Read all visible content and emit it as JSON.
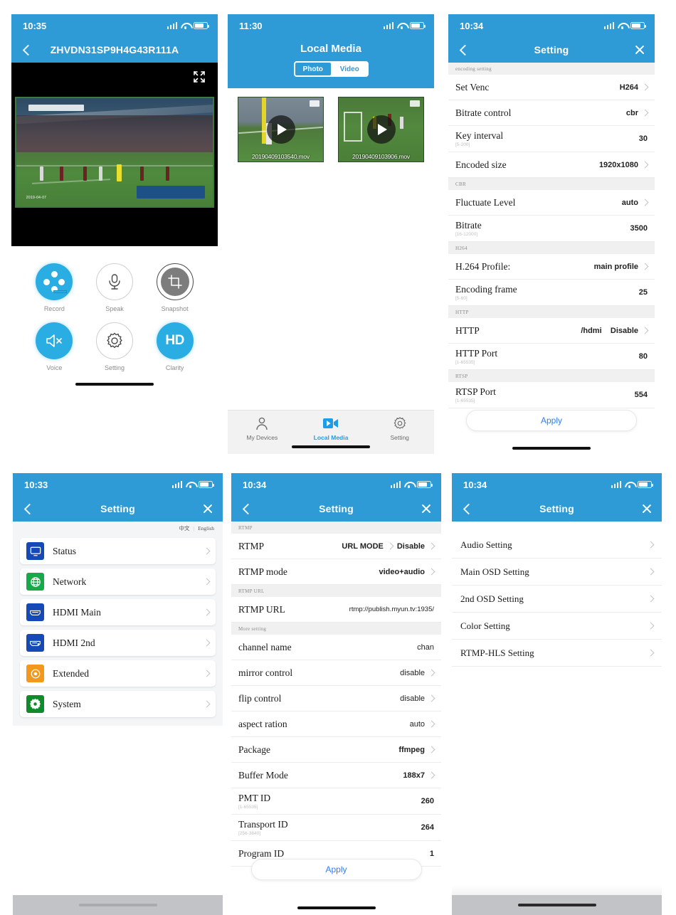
{
  "panel1": {
    "status_time": "10:35",
    "nav_title": "ZHVDN31SP9H4G43R111A",
    "video_timestamp": "2019-04-07",
    "controls": [
      {
        "label": "Record",
        "icon": "film-reel-icon"
      },
      {
        "label": "Speak",
        "icon": "microphone-icon"
      },
      {
        "label": "Snapshot",
        "icon": "crop-icon"
      },
      {
        "label": "Voice",
        "icon": "speaker-mute-icon"
      },
      {
        "label": "Setting",
        "icon": "gear-icon"
      },
      {
        "label": "Clarity",
        "icon": "hd-icon"
      }
    ],
    "clarity_text": "HD"
  },
  "panel2": {
    "status_time": "11:30",
    "nav_title": "Local Media",
    "segments": [
      {
        "label": "Photo",
        "active": true
      },
      {
        "label": "Video",
        "active": false
      }
    ],
    "media": [
      {
        "filename": "20190409103540.mov"
      },
      {
        "filename": "20190409103906.mov"
      }
    ],
    "tabs": [
      {
        "label": "My Devices",
        "icon": "person-icon",
        "active": false
      },
      {
        "label": "Local Media",
        "icon": "video-camera-icon",
        "active": true
      },
      {
        "label": "Setting",
        "icon": "gear-icon",
        "active": false
      }
    ]
  },
  "panel3": {
    "status_time": "10:34",
    "nav_title": "Setting",
    "sections": [
      {
        "header": "encoding setting",
        "rows": [
          {
            "label": "Set Venc",
            "sub": "",
            "value": "H264",
            "chevron": true
          },
          {
            "label": "Bitrate control",
            "sub": "",
            "value": "cbr",
            "chevron": true
          },
          {
            "label": "Key interval",
            "sub": "[5-200]",
            "value": "30",
            "chevron": false
          },
          {
            "label": "Encoded size",
            "sub": "",
            "value": "1920x1080",
            "chevron": true
          }
        ]
      },
      {
        "header": "CBR",
        "rows": [
          {
            "label": "Fluctuate Level",
            "sub": "",
            "value": "auto",
            "chevron": true
          },
          {
            "label": "Bitrate",
            "sub": "[16-12000]",
            "value": "3500",
            "chevron": false
          }
        ]
      },
      {
        "header": "H264",
        "rows": [
          {
            "label": "H.264 Profile:",
            "sub": "",
            "value": "main profile",
            "chevron": true
          },
          {
            "label": "Encoding frame",
            "sub": "[5-60]",
            "value": "25",
            "chevron": false
          }
        ]
      },
      {
        "header": "HTTP",
        "rows": [
          {
            "label": "HTTP",
            "sub": "",
            "value": "/hdmi    Disable",
            "chevron": true
          },
          {
            "label": "HTTP Port",
            "sub": "[1-65535]",
            "value": "80",
            "chevron": false
          }
        ]
      },
      {
        "header": "RTSP",
        "rows": [
          {
            "label": "RTSP Port",
            "sub": "[1-65535]",
            "value": "554",
            "chevron": false
          }
        ]
      }
    ],
    "apply_label": "Apply"
  },
  "panel4": {
    "status_time": "10:33",
    "nav_title": "Setting",
    "lang_cn": "中文",
    "lang_sep": "|",
    "lang_en": "English",
    "items": [
      {
        "label": "Status",
        "icon": "monitor-icon",
        "color": "blue-ic"
      },
      {
        "label": "Network",
        "icon": "globe-icon",
        "color": "green-ic"
      },
      {
        "label": "HDMI Main",
        "icon": "hdmi-port-icon",
        "color": "blue-ic"
      },
      {
        "label": "HDMI 2nd",
        "icon": "hdmi-port-icon",
        "color": "blue-ic"
      },
      {
        "label": "Extended",
        "icon": "target-icon",
        "color": "orange-ic"
      },
      {
        "label": "System",
        "icon": "gear-icon",
        "color": "darkgreen-ic"
      }
    ]
  },
  "panel5": {
    "status_time": "10:34",
    "nav_title": "Setting",
    "sections": [
      {
        "header": "RTMP",
        "rows": [
          {
            "label": "RTMP",
            "sub": "",
            "value": "URL MODE",
            "value2": "Disable",
            "chevron": true
          },
          {
            "label": "RTMP mode",
            "sub": "",
            "value": "video+audio",
            "chevron": true
          }
        ]
      },
      {
        "header": "RTMP URL",
        "rows": [
          {
            "label": "RTMP URL",
            "sub": "",
            "value": "rtmp://publish.myun.tv:1935/",
            "chevron": false,
            "thin": true
          }
        ]
      },
      {
        "header": "More setting",
        "rows": [
          {
            "label": "channel name",
            "sub": "",
            "value": "chan",
            "chevron": false,
            "serif": false
          },
          {
            "label": "mirror control",
            "sub": "",
            "value": "disable",
            "chevron": true,
            "serif": false
          },
          {
            "label": "flip control",
            "sub": "",
            "value": "disable",
            "chevron": true,
            "serif": false
          },
          {
            "label": "aspect ration",
            "sub": "",
            "value": "auto",
            "chevron": true,
            "serif": false
          },
          {
            "label": "Package",
            "sub": "",
            "value": "ffmpeg",
            "chevron": true
          },
          {
            "label": "Buffer Mode",
            "sub": "",
            "value": "188x7",
            "chevron": true
          },
          {
            "label": "PMT ID",
            "sub": "[1-65535]",
            "value": "260",
            "chevron": false
          },
          {
            "label": "Transport ID",
            "sub": "[256-3840]",
            "value": "264",
            "chevron": false
          },
          {
            "label": "Program ID",
            "sub": "",
            "value": "1",
            "chevron": false
          }
        ]
      }
    ],
    "apply_label": "Apply"
  },
  "panel6": {
    "status_time": "10:34",
    "nav_title": "Setting",
    "items": [
      {
        "label": "Audio Setting"
      },
      {
        "label": "Main OSD Setting"
      },
      {
        "label": "2nd OSD Setting"
      },
      {
        "label": "Color Setting"
      },
      {
        "label": "RTMP-HLS Setting"
      }
    ]
  },
  "colors": {
    "header_blue": "#2E9BD6",
    "accent_blue": "#29ADE3",
    "apply_blue": "#2F7DF6"
  }
}
